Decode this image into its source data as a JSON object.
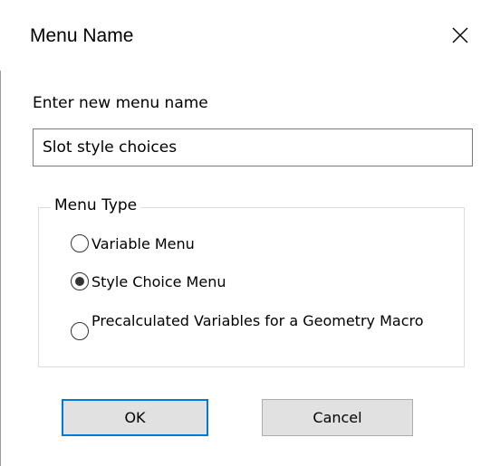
{
  "dialog": {
    "title": "Menu Name",
    "close_icon": "close-icon"
  },
  "prompt": "Enter new menu name",
  "name_input": {
    "value": "Slot style choices"
  },
  "menu_type": {
    "label": "Menu Type",
    "options": [
      {
        "label": "Variable Menu",
        "selected": false
      },
      {
        "label": "Style Choice Menu",
        "selected": true
      },
      {
        "label": "Precalculated Variables for a Geometry Macro",
        "selected": false
      }
    ]
  },
  "buttons": {
    "ok": "OK",
    "cancel": "Cancel"
  },
  "colors": {
    "default_button_border": "#0078d7",
    "button_face": "#e1e1e1"
  }
}
